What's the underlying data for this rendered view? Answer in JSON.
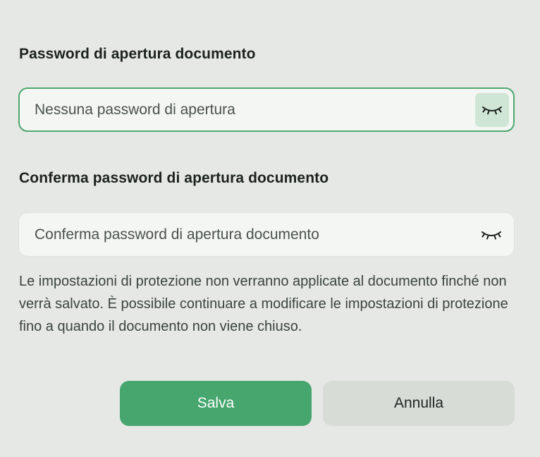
{
  "open_password": {
    "label": "Password di apertura documento",
    "placeholder": "Nessuna password di apertura",
    "value": "",
    "toggle_icon": "eye-closed-icon"
  },
  "confirm_password": {
    "label": "Conferma password di apertura documento",
    "placeholder": "Conferma password di apertura documento",
    "value": "",
    "toggle_icon": "eye-closed-icon"
  },
  "info_text": "Le impostazioni di protezione non verranno applicate al documento finché non verrà salvato. È possibile continuare a modificare le impostazioni di protezione fino a quando il documento non viene chiuso.",
  "buttons": {
    "save_label": "Salva",
    "cancel_label": "Annulla"
  },
  "colors": {
    "accent": "#46a66e",
    "focus_border": "#4ea871",
    "background": "#e5e8e4"
  }
}
